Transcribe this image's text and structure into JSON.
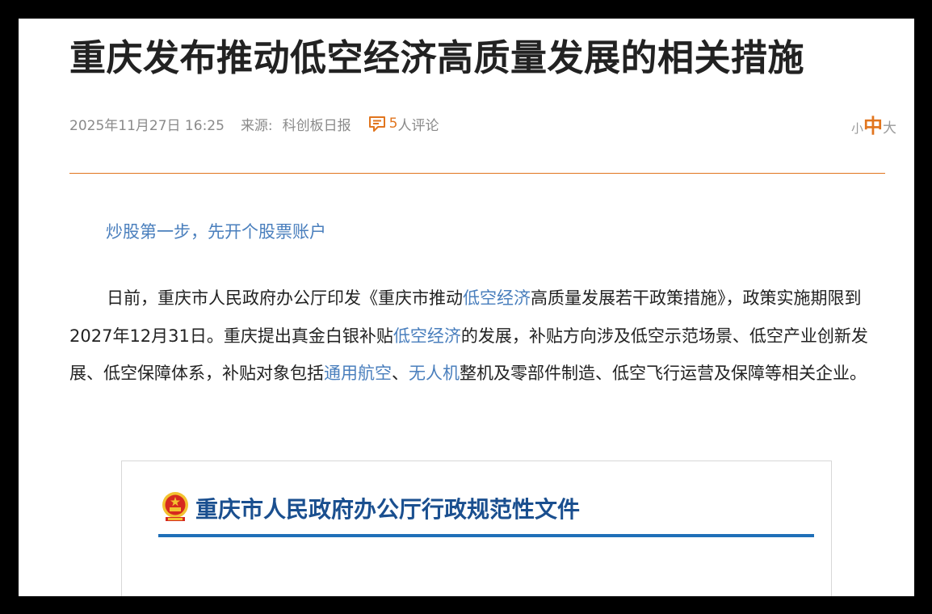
{
  "article": {
    "title": "重庆发布推动低空经济高质量发展的相关措施",
    "date": "2025年11月27日 16:25",
    "source_label": "来源:",
    "source": "科创板日报",
    "comments": {
      "count": "5",
      "label": "人评论",
      "icon": "comment-icon"
    },
    "font_size": {
      "small": "小",
      "mid": "中",
      "large": "大"
    },
    "promo_link": "炒股第一步，先开个股票账户",
    "body": {
      "p1": "日前，重庆市人民政府办公厅印发《重庆市推动",
      "link1": "低空经济",
      "p2": "高质量发展若干政策措施》，政策实施期限到2027年12月31日。重庆提出真金白银补贴",
      "link2": "低空经济",
      "p3": "的发展，补贴方向涉及低空示范场景、低空产业创新发展、低空保障体系，补贴对象包括",
      "link3": "通用航空",
      "p4": "、",
      "link4": "无人机",
      "p5": "整机及零部件制造、低空飞行运营及保障等相关企业。"
    },
    "document_image": {
      "heading": "重庆市人民政府办公厅行政规范性文件",
      "emblem_icon": "national-emblem-icon"
    }
  },
  "colors": {
    "accent": "#e1751e",
    "link": "#4a7fbd",
    "doc_blue": "#1f6fb8",
    "doc_heading": "#1a4f8f",
    "text": "#222222",
    "meta": "#8a8a8a"
  }
}
